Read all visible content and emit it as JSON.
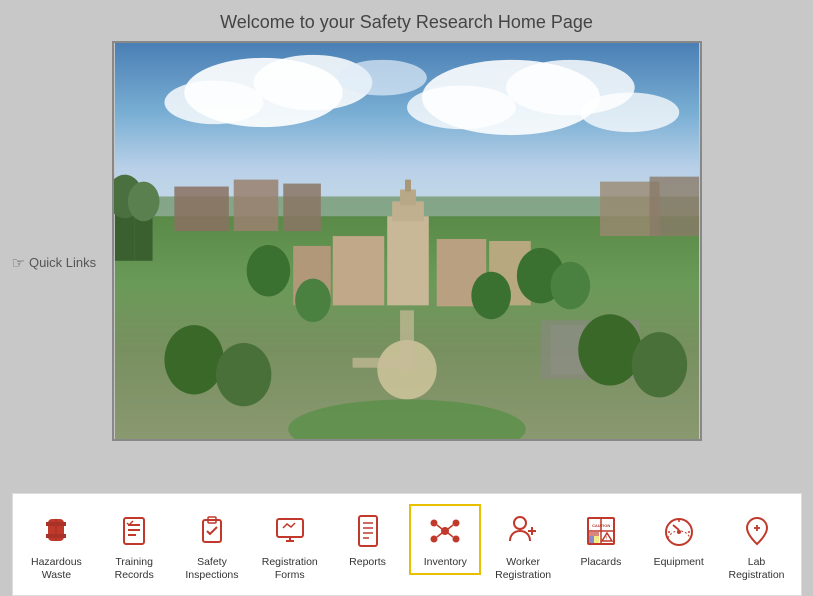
{
  "page": {
    "title": "Welcome to your Safety Research Home Page",
    "quickLinks": "Quick Links"
  },
  "navbar": {
    "items": [
      {
        "id": "hazardous-waste",
        "label": "Hazardous\nWaste",
        "active": false,
        "icon": "barrel"
      },
      {
        "id": "training-records",
        "label": "Training\nRecords",
        "active": false,
        "icon": "checklist"
      },
      {
        "id": "safety-inspections",
        "label": "Safety\nInspections",
        "active": false,
        "icon": "clipboard-check"
      },
      {
        "id": "registration-forms",
        "label": "Registration\nForms",
        "active": false,
        "icon": "monitor"
      },
      {
        "id": "reports",
        "label": "Reports",
        "active": false,
        "icon": "doc"
      },
      {
        "id": "inventory",
        "label": "Inventory",
        "active": true,
        "icon": "molecule"
      },
      {
        "id": "worker-registration",
        "label": "Worker\nRegistration",
        "active": false,
        "icon": "person-plus"
      },
      {
        "id": "placards",
        "label": "Placards",
        "active": false,
        "icon": "warning-grid"
      },
      {
        "id": "equipment",
        "label": "Equipment",
        "active": false,
        "icon": "gauge"
      },
      {
        "id": "lab-registration",
        "label": "Lab\nRegistration",
        "active": false,
        "icon": "pin-plus"
      }
    ]
  }
}
